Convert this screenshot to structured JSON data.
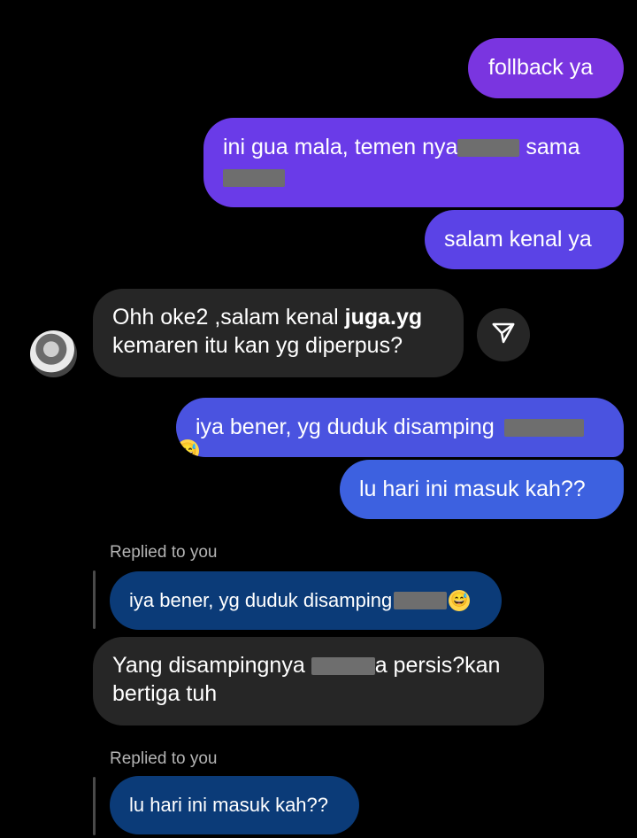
{
  "top_status": "",
  "messages": {
    "sent1": "follback ya",
    "sent2_before": "ini gua mala, temen nya",
    "sent2_after": " sama",
    "sent3": "salam kenal ya",
    "recv1_part1": "Ohh oke2 ,salam kenal ",
    "recv1_bold": "juga.yg",
    "recv1_line2": "kemaren itu kan yg diperpus?",
    "sent4": "iya bener, yg duduk disamping",
    "sent5": "lu hari ini masuk kah??",
    "recv2_before": "Yang disampingnya",
    "recv2_after": "a persis?kan",
    "recv2_line2": "bertiga tuh"
  },
  "replies": [
    {
      "label": "Replied to you",
      "quote": "iya bener, yg duduk disamping"
    },
    {
      "label": "Replied to you",
      "quote": "lu hari ini masuk kah??"
    }
  ],
  "emoji_char": "😅",
  "icons": {
    "share": "send-icon",
    "avatar": "avatar"
  },
  "colors": {
    "background": "#000000",
    "received_bubble": "#262626",
    "reply_quote": "#0b3b78",
    "sent_gradient_top": "#7a35e0",
    "sent_gradient_bottom": "#3d61e0"
  }
}
